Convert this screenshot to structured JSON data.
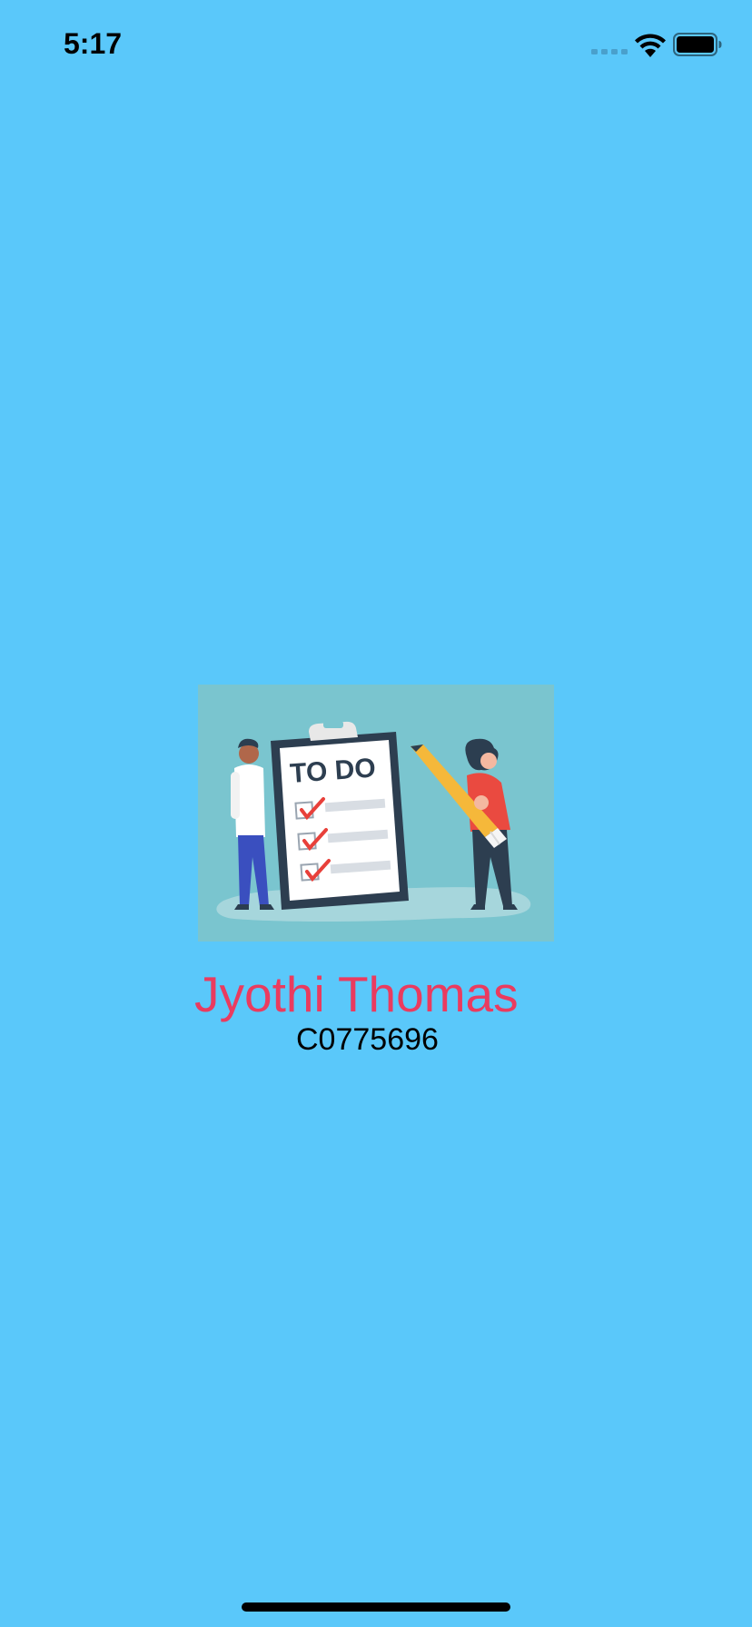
{
  "status_bar": {
    "time": "5:17",
    "icons": [
      "signal-icon",
      "wifi-icon",
      "battery-icon"
    ]
  },
  "splash": {
    "image_text": "TO DO",
    "image_icon": "todo-checklist-illustration",
    "name": "Jyothi Thomas",
    "student_id": "C0775696"
  },
  "colors": {
    "background": "#5ac8fa",
    "name": "#ea3b5f",
    "id": "#000000",
    "image_background": "#7ac5cf"
  }
}
